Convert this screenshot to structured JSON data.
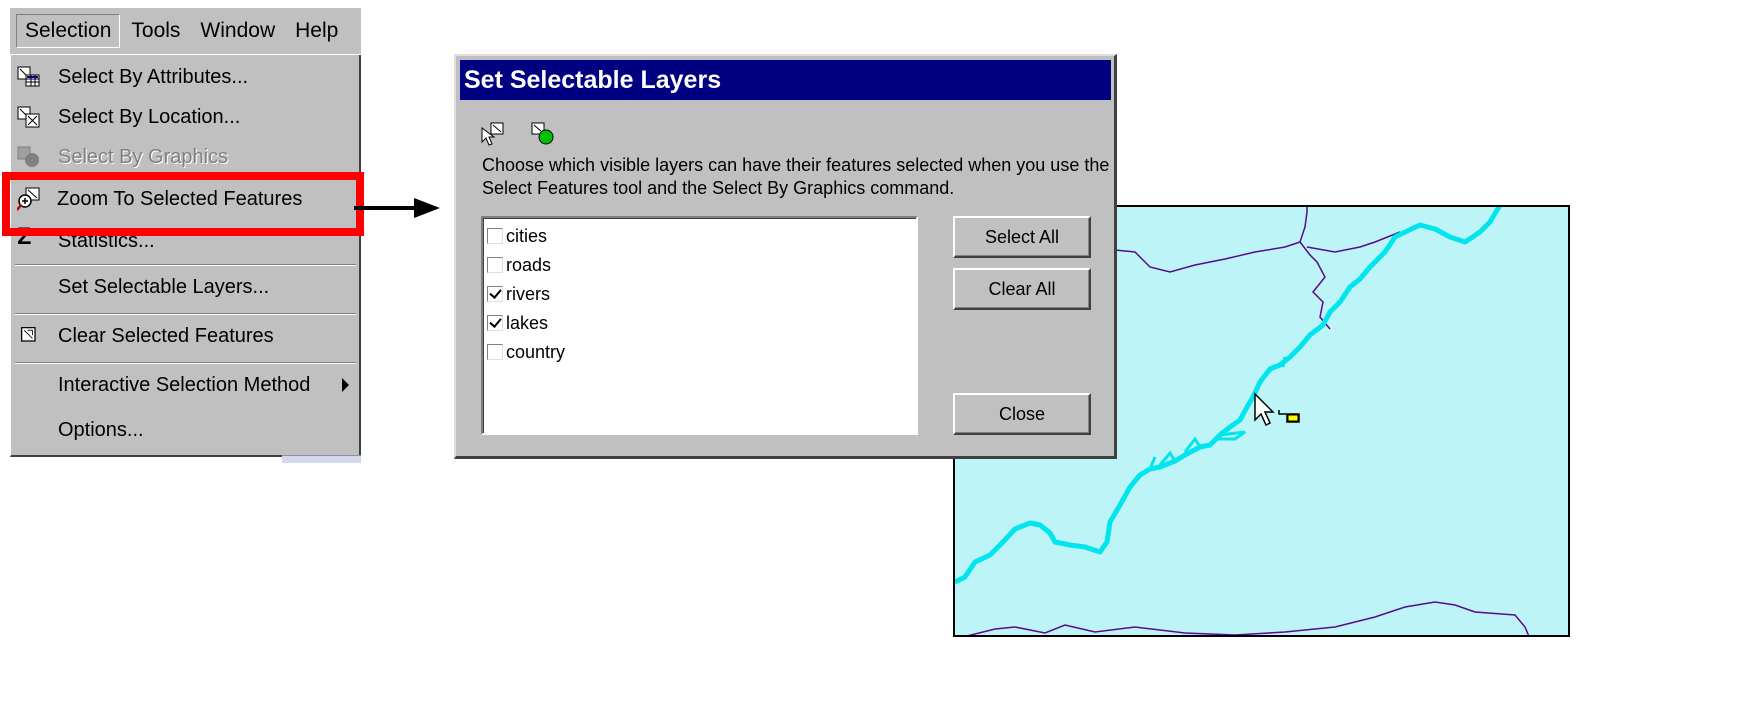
{
  "menubar": {
    "items": [
      {
        "label": "Selection",
        "active": true
      },
      {
        "label": "Tools",
        "active": false
      },
      {
        "label": "Window",
        "active": false
      },
      {
        "label": "Help",
        "active": false
      }
    ]
  },
  "selection_menu": {
    "items": [
      {
        "label": "Select By Attributes...",
        "icon": "select-by-attributes-icon",
        "enabled": true
      },
      {
        "label": "Select By Location...",
        "icon": "select-by-location-icon",
        "enabled": true
      },
      {
        "label": "Select By Graphics",
        "icon": "select-by-graphics-icon",
        "enabled": false
      },
      {
        "label": "Zoom To Selected Features",
        "icon": "zoom-to-selected-icon",
        "enabled": true,
        "highlighted": true
      },
      {
        "label": "Statistics...",
        "icon": "sigma-icon",
        "enabled": true
      },
      {
        "label": "Set Selectable Layers...",
        "icon": "",
        "enabled": true
      },
      {
        "label": "Clear Selected Features",
        "icon": "clear-selection-icon",
        "enabled": true
      },
      {
        "label": "Interactive Selection Method",
        "icon": "",
        "enabled": true,
        "submenu": true
      },
      {
        "label": "Options...",
        "icon": "",
        "enabled": true
      }
    ]
  },
  "dialog": {
    "title": "Set Selectable Layers",
    "description": "Choose which visible layers can have their features selected when you use the Select Features tool and the Select By Graphics command.",
    "icons": [
      "select-features-icon",
      "select-by-graphics-icon"
    ],
    "layers": [
      {
        "name": "cities",
        "checked": false
      },
      {
        "name": "roads",
        "checked": false
      },
      {
        "name": "rivers",
        "checked": true
      },
      {
        "name": "lakes",
        "checked": true
      },
      {
        "name": "country",
        "checked": false
      }
    ],
    "buttons": {
      "select_all": "Select All",
      "clear_all": "Clear All",
      "close": "Close"
    }
  },
  "colors": {
    "highlight": "#ff0000",
    "titlebar": "#000080",
    "map_background": "#bdf4f8",
    "river": "#00e5ee",
    "roads": "#5a0a8a"
  }
}
